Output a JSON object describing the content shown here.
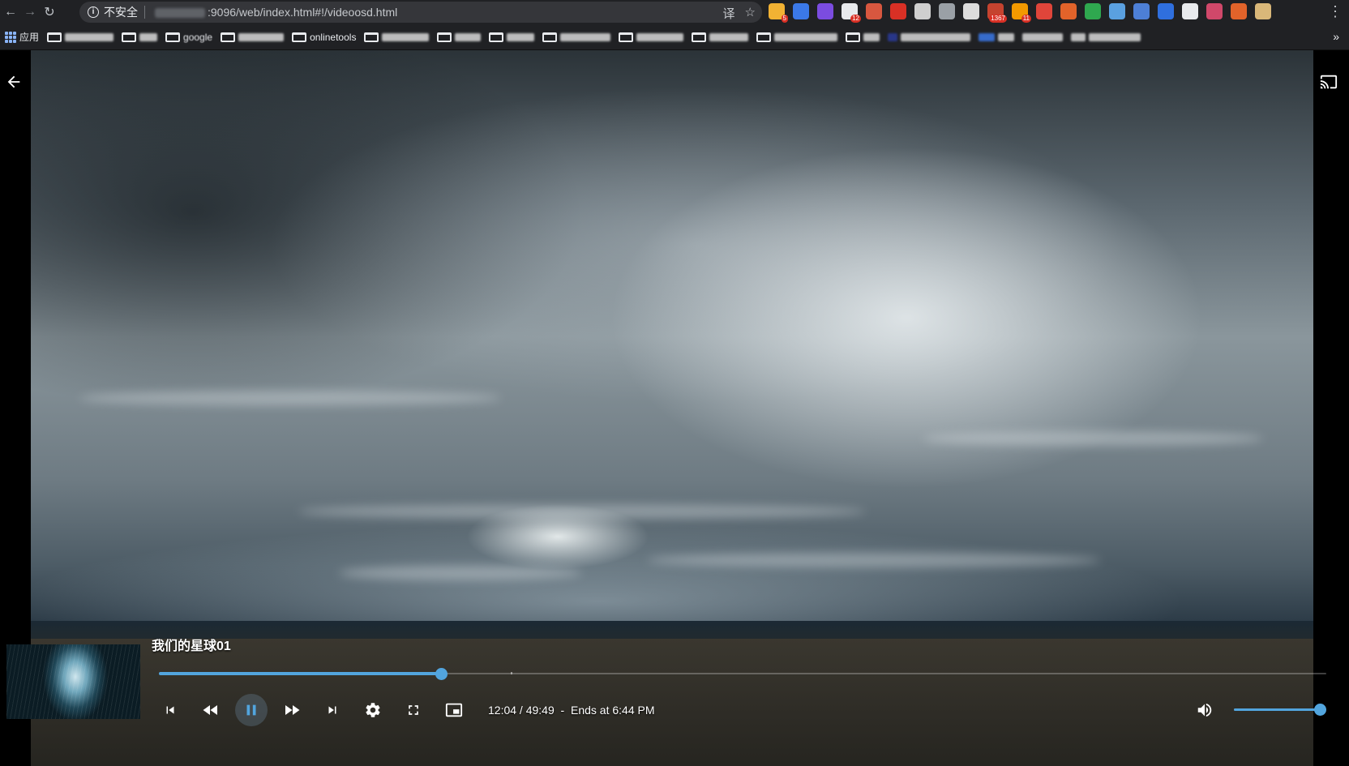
{
  "browser": {
    "security_label": "不安全",
    "url_visible": ":9096/web/index.html#!/videoosd.html",
    "extensions": [
      {
        "name": "extension-grid-icon",
        "color": "#f2b233",
        "badge": "5"
      },
      {
        "name": "extension-f-icon",
        "color": "#3b78e7",
        "badge": ""
      },
      {
        "name": "extension-rp-icon",
        "color": "#7b4ce0",
        "badge": ""
      },
      {
        "name": "extension-octocat-icon",
        "color": "#e8eaed",
        "badge": "12"
      },
      {
        "name": "extension-image-icon",
        "color": "#d8573f",
        "badge": ""
      },
      {
        "name": "extension-abp-icon",
        "color": "#d93025",
        "badge": ""
      },
      {
        "name": "extension-cat-icon",
        "color": "#cfcfcf",
        "badge": ""
      },
      {
        "name": "extension-pocket-icon",
        "color": "#9aa0a6",
        "badge": ""
      },
      {
        "name": "extension-doc-icon",
        "color": "#dcdcdc",
        "badge": ""
      },
      {
        "name": "extension-mail-icon",
        "color": "#c5432f",
        "badge": "1367"
      },
      {
        "name": "extension-rss-icon",
        "color": "#f29900",
        "badge": "11"
      },
      {
        "name": "extension-shield-red-icon",
        "color": "#e0453a",
        "badge": ""
      },
      {
        "name": "extension-gitlab-icon",
        "color": "#e2632a",
        "badge": ""
      },
      {
        "name": "extension-shield-green-icon",
        "color": "#2fa84f",
        "badge": ""
      },
      {
        "name": "extension-screenshot-icon",
        "color": "#5aa0e0",
        "badge": ""
      },
      {
        "name": "extension-mi-icon",
        "color": "#4d7fd6",
        "badge": ""
      },
      {
        "name": "extension-save-icon",
        "color": "#2f6fde",
        "badge": ""
      },
      {
        "name": "extension-ghost-icon",
        "color": "#e8eaed",
        "badge": ""
      },
      {
        "name": "extension-red-box-icon",
        "color": "#d0486a",
        "badge": ""
      },
      {
        "name": "extension-fox-icon",
        "color": "#e2632a",
        "badge": ""
      },
      {
        "name": "extension-folder-icon",
        "color": "#d9b779",
        "badge": ""
      }
    ]
  },
  "bookmarks": {
    "apps_label": "应用",
    "items": [
      {
        "label": "google"
      },
      {
        "label": "onlinetools"
      }
    ]
  },
  "player": {
    "title": "我们的星球01",
    "current_time": "12:04",
    "duration": "49:49",
    "ends_at": "Ends at 6:44 PM",
    "time_display": "12:04 / 49:49  -  Ends at 6:44 PM",
    "progress_fraction": 0.242,
    "volume_fraction": 1.0,
    "is_paused": false,
    "accent_color": "#52a5de"
  }
}
